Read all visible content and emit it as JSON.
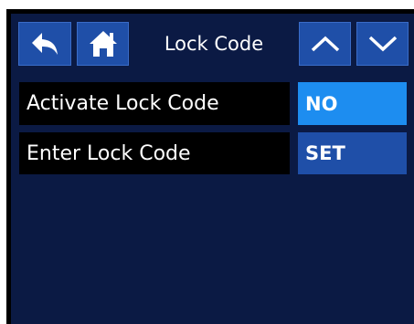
{
  "header": {
    "title": "Lock Code",
    "back_icon": "back-arrow-icon",
    "home_icon": "home-icon",
    "up_icon": "chevron-up-icon",
    "down_icon": "chevron-down-icon"
  },
  "rows": [
    {
      "label": "Activate Lock Code",
      "value": "NO",
      "color": "#1d8df0"
    },
    {
      "label": "Enter Lock Code",
      "value": "SET",
      "color": "#1f4fa8"
    }
  ],
  "colors": {
    "background": "#0b1a44",
    "button": "#1f4fa8",
    "selected": "#1d8df0",
    "frame": "#000000"
  }
}
